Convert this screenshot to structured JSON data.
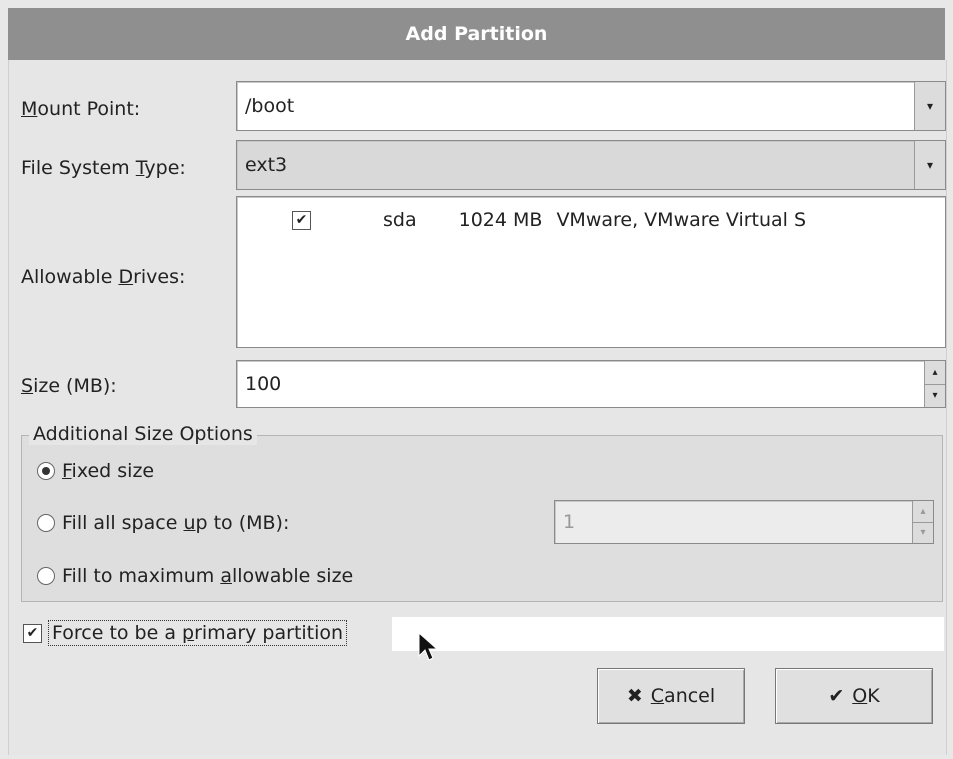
{
  "window": {
    "title": "Add Partition"
  },
  "mount_point": {
    "label_prefix": "M",
    "label_rest": "ount Point:",
    "value": "/boot"
  },
  "fs_type": {
    "label_pre": "File System ",
    "label_u": "T",
    "label_post": "ype:",
    "value": "ext3"
  },
  "drives": {
    "label_pre": "Allowable ",
    "label_u": "D",
    "label_post": "rives:",
    "rows": [
      {
        "checked": "✔",
        "name": "sda",
        "size": "1024 MB",
        "model": "VMware, VMware Virtual S"
      }
    ]
  },
  "size": {
    "label_u": "S",
    "label_rest": "ize (MB):",
    "value": "100"
  },
  "size_options": {
    "title": "Additional Size Options",
    "fixed": {
      "u": "F",
      "rest": "ixed size"
    },
    "fill_upto": {
      "pre": "Fill all space ",
      "u": "u",
      "post": "p to (MB):",
      "value": "1"
    },
    "fill_max": {
      "pre": "Fill to maximum ",
      "u": "a",
      "post": "llowable size"
    }
  },
  "primary": {
    "checked": "✔",
    "pre": "Force to be a ",
    "u": "p",
    "post": "rimary partition"
  },
  "buttons": {
    "cancel": {
      "icon": "✖",
      "u": "C",
      "rest": "ancel"
    },
    "ok": {
      "icon": "✔",
      "u": "O",
      "rest": "K"
    }
  },
  "icons": {
    "combo_arrow": "▾",
    "spin_up": "▴",
    "spin_down": "▾"
  }
}
